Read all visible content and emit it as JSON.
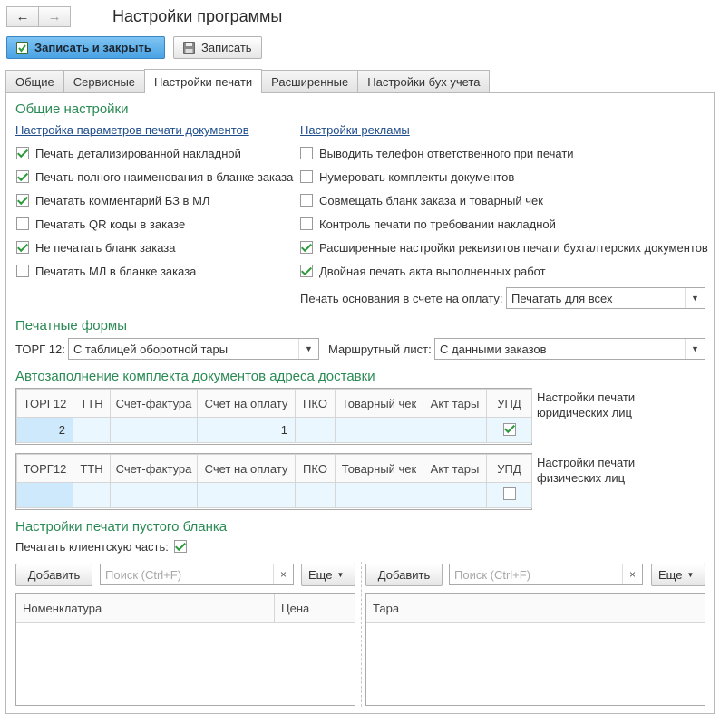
{
  "window": {
    "title": "Настройки программы"
  },
  "nav": {
    "back": "←",
    "forward": "→"
  },
  "toolbar": {
    "save_close": "Записать и закрыть",
    "save": "Записать"
  },
  "tabs": [
    "Общие",
    "Сервисные",
    "Настройки печати",
    "Расширенные",
    "Настройки бух учета"
  ],
  "active_tab": "Настройки печати",
  "general": {
    "heading": "Общие настройки",
    "left_link": "Настройка параметров печати документов",
    "right_link": "Настройки рекламы",
    "left_items": [
      {
        "label": "Печать детализированной накладной",
        "checked": true
      },
      {
        "label": "Печать полного наименования в бланке заказа",
        "checked": true
      },
      {
        "label": "Печатать комментарий БЗ в МЛ",
        "checked": true
      },
      {
        "label": "Печатать QR коды в заказе",
        "checked": false
      },
      {
        "label": "Не печатать бланк заказа",
        "checked": true
      },
      {
        "label": "Печатать МЛ в бланке заказа",
        "checked": false
      }
    ],
    "right_items": [
      {
        "label": "Выводить телефон ответственного при печати",
        "checked": false
      },
      {
        "label": "Нумеровать комплекты документов",
        "checked": false
      },
      {
        "label": "Совмещать бланк заказа и товарный чек",
        "checked": false
      },
      {
        "label": "Контроль печати по требовании накладной",
        "checked": false
      },
      {
        "label": "Расширенные настройки реквизитов печати бухгалтерских документов",
        "checked": true
      },
      {
        "label": "Двойная печать акта выполненных работ",
        "checked": true
      }
    ],
    "basis_label": "Печать основания в счете на оплату:",
    "basis_value": "Печатать для всех"
  },
  "forms": {
    "heading": "Печатные формы",
    "torg_label": "ТОРГ 12:",
    "torg_value": "С таблицей оборотной тары",
    "route_label": "Маршрутный лист:",
    "route_value": "С данными заказов"
  },
  "autofill": {
    "heading": "Автозаполнение комплекта документов адреса доставки",
    "columns": [
      "ТОРГ12",
      "ТТН",
      "Счет-фактура",
      "Счет на оплату",
      "ПКО",
      "Товарный чек",
      "Акт тары",
      "УПД"
    ],
    "legal": {
      "caption": "Настройки печати юридических лиц",
      "values": [
        "2",
        "",
        "",
        "1",
        "",
        "",
        ""
      ],
      "upd_checked": true
    },
    "physical": {
      "caption": "Настройки печати физических лиц",
      "values": [
        "",
        "",
        "",
        "",
        "",
        "",
        ""
      ],
      "upd_checked": false
    }
  },
  "blank": {
    "heading": "Настройки печати пустого бланка",
    "client_part_label": "Печатать клиентскую часть:",
    "client_part_checked": true,
    "left": {
      "add": "Добавить",
      "search_placeholder": "Поиск (Ctrl+F)",
      "clear": "×",
      "more": "Еще",
      "columns": [
        "Номенклатура",
        "Цена"
      ]
    },
    "right": {
      "add": "Добавить",
      "search_placeholder": "Поиск (Ctrl+F)",
      "clear": "×",
      "more": "Еще",
      "columns": [
        "Тара"
      ]
    }
  },
  "icons": {
    "save_close": "document-check-icon",
    "save": "floppy-disk-icon",
    "dropdown": "chevron-down-icon"
  },
  "colors": {
    "section_heading": "#2a8a54",
    "link": "#1e4d8c",
    "primary_button": "#f3d44a",
    "table_row": "#eaf7fe"
  }
}
